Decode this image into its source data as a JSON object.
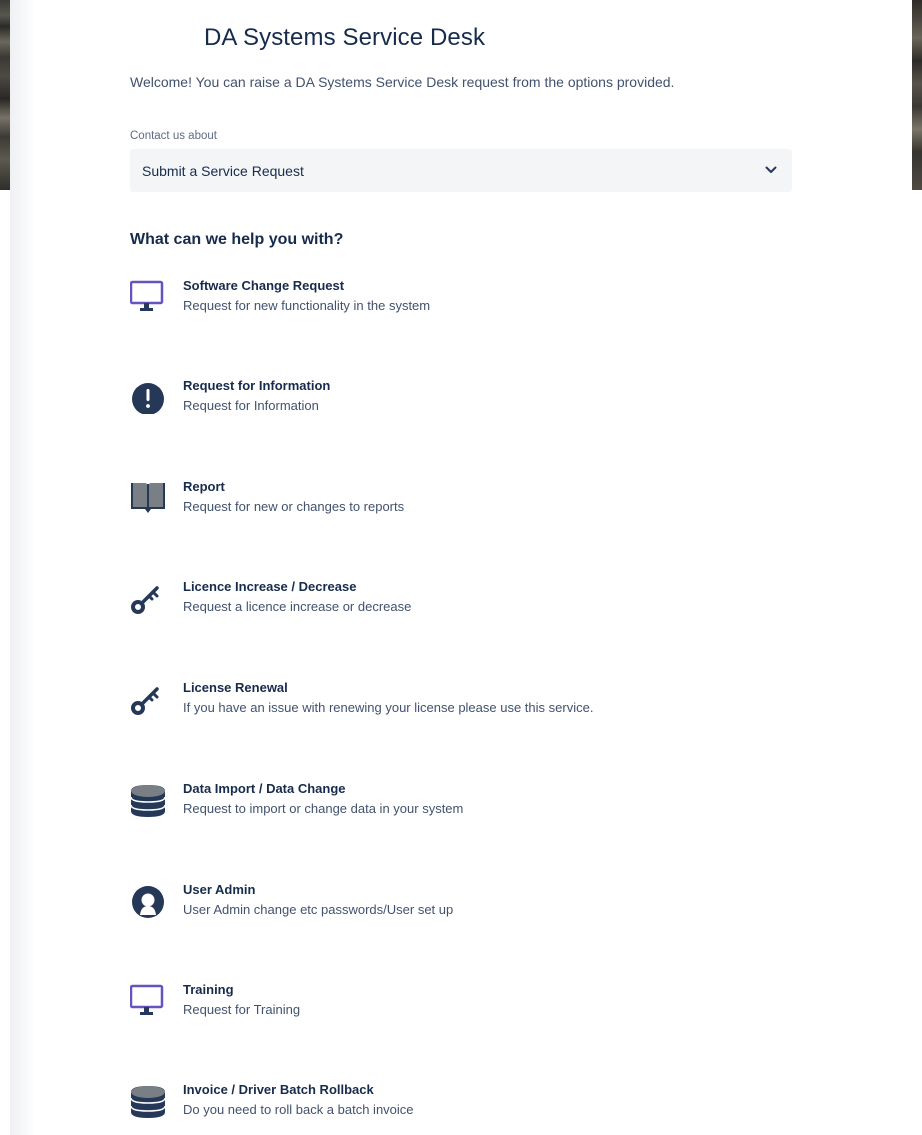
{
  "header": {
    "title": "DA Systems Service Desk",
    "welcome": "Welcome! You can raise a DA Systems Service Desk request from the options provided."
  },
  "contact": {
    "label": "Contact us about",
    "selected": "Submit a Service Request"
  },
  "help_heading": "What can we help you with?",
  "colors": {
    "monitor_icon": "#6554c0",
    "dark_icon": "#253858"
  },
  "requests": [
    {
      "name": "Software Change Request",
      "description": "Request for new functionality in the system",
      "icon": "monitor-icon"
    },
    {
      "name": "Request for Information",
      "description": "Request for Information",
      "icon": "exclamation-icon"
    },
    {
      "name": "Report",
      "description": "Request for new or changes to reports",
      "icon": "book-icon"
    },
    {
      "name": "Licence Increase / Decrease",
      "description": "Request a licence increase or decrease",
      "icon": "key-icon"
    },
    {
      "name": "License Renewal",
      "description": "If you have an issue with renewing your license please use this service.",
      "icon": "key-icon"
    },
    {
      "name": "Data Import / Data Change",
      "description": "Request to import or change data in your system",
      "icon": "database-icon"
    },
    {
      "name": "User Admin",
      "description": "User Admin change etc passwords/User set up",
      "icon": "user-icon"
    },
    {
      "name": "Training",
      "description": "Request for Training",
      "icon": "monitor-icon"
    },
    {
      "name": "Invoice / Driver Batch Rollback",
      "description": "Do you need to roll back a batch invoice",
      "icon": "database-icon"
    }
  ]
}
